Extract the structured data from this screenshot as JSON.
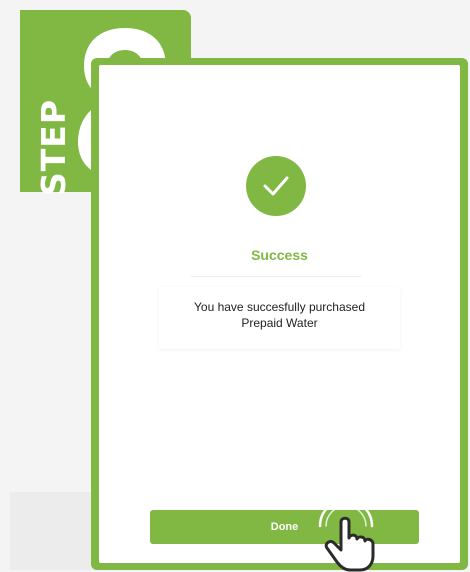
{
  "step": {
    "word": "STEP",
    "number": "8"
  },
  "success": {
    "title": "Success",
    "message_line1": "You have succesfully purchased",
    "message_line2": "Prepaid Water"
  },
  "actions": {
    "done_label": "Done"
  },
  "icons": {
    "status": "checkmark-icon",
    "pointer": "tapping-hand-icon"
  },
  "colors": {
    "brand_green": "#80b843",
    "text_dark": "#222222",
    "background": "#f4f4f4"
  }
}
